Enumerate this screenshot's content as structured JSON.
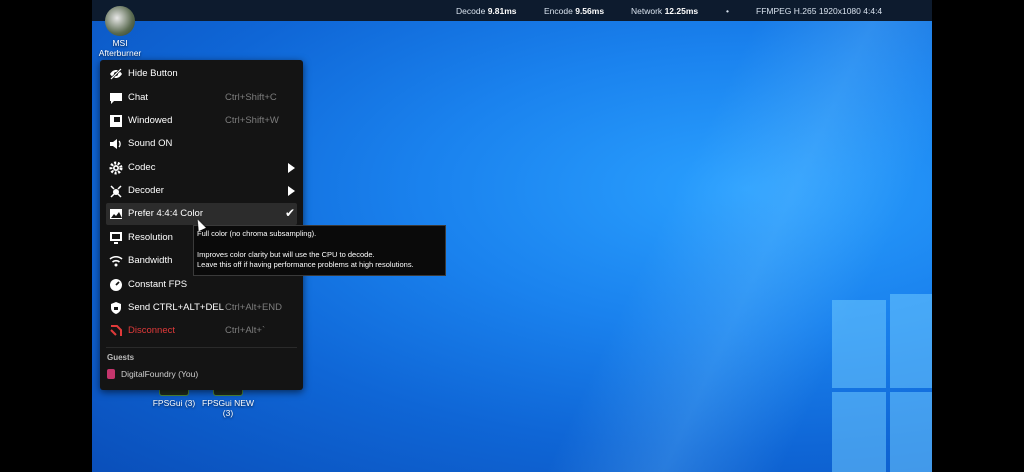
{
  "topbar": {
    "decode_label": "Decode",
    "decode_value": "9.81ms",
    "encode_label": "Encode",
    "encode_value": "9.56ms",
    "network_label": "Network",
    "network_value": "12.25ms",
    "bullet": "•",
    "codec_info": "FFMPEG H.265 1920x1080 4:4:4"
  },
  "desktop_icons": {
    "afterburner": {
      "line1": "MSI",
      "line2": "Afterburner"
    },
    "fpsgui": {
      "line1": "FPSGui (3)"
    },
    "fpsgui_new": {
      "line1": "FPSGui NEW",
      "line2": "(3)"
    }
  },
  "menu": {
    "items": [
      {
        "label": "Hide Button",
        "shortcut": "",
        "icon": "eye-slash-icon"
      },
      {
        "label": "Chat",
        "shortcut": "Ctrl+Shift+C",
        "icon": "chat-icon"
      },
      {
        "label": "Windowed",
        "shortcut": "Ctrl+Shift+W",
        "icon": "window-icon"
      },
      {
        "label": "Sound ON",
        "shortcut": "",
        "icon": "speaker-icon"
      },
      {
        "label": "Codec",
        "shortcut": "",
        "icon": "gear-icon"
      },
      {
        "label": "Decoder",
        "shortcut": "",
        "icon": "decoder-icon"
      },
      {
        "label": "Prefer 4:4:4 Color",
        "shortcut": "",
        "icon": "image-icon"
      },
      {
        "label": "Resolution",
        "shortcut": "",
        "icon": "monitor-icon"
      },
      {
        "label": "Bandwidth",
        "shortcut": "",
        "icon": "wifi-icon"
      },
      {
        "label": "Constant FPS",
        "shortcut": "",
        "icon": "gauge-icon"
      },
      {
        "label": "Send CTRL+ALT+DEL",
        "shortcut": "Ctrl+Alt+END",
        "icon": "shield-icon"
      },
      {
        "label": "Disconnect",
        "shortcut": "Ctrl+Alt+`",
        "icon": "disconnect-icon"
      }
    ],
    "guests_heading": "Guests",
    "guest_name": "DigitalFoundry (You)"
  },
  "tooltip": {
    "line1": "Full color (no chroma subsampling).",
    "line2": "Improves color clarity but will use the CPU to decode.",
    "line3": "Leave this off if having performance problems at high resolutions."
  },
  "colors": {
    "danger": "#e03a3a",
    "menu_bg": "#141414",
    "desktop_blue": "#1a82ee"
  }
}
